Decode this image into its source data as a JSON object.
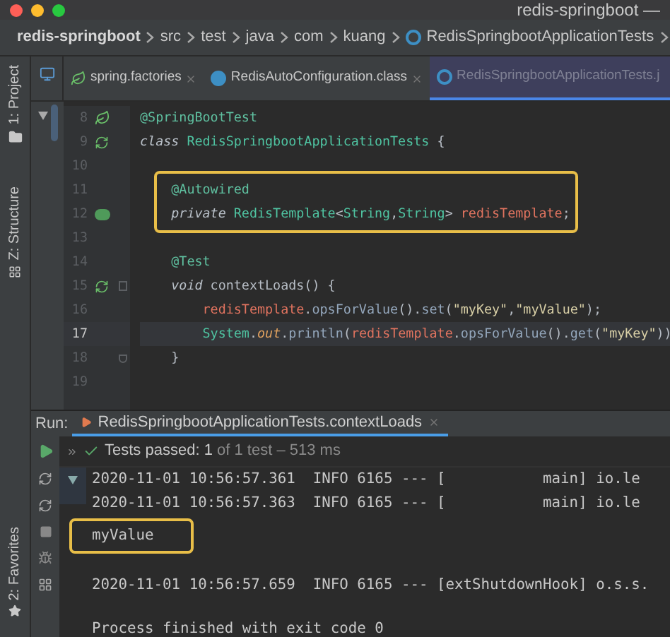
{
  "window": {
    "title": "redis-springboot —"
  },
  "breadcrumbs": [
    {
      "label": "redis-springboot",
      "kind": "project"
    },
    {
      "label": "src",
      "kind": "folder"
    },
    {
      "label": "test",
      "kind": "folder"
    },
    {
      "label": "java",
      "kind": "folder"
    },
    {
      "label": "com",
      "kind": "folder"
    },
    {
      "label": "kuang",
      "kind": "folder"
    },
    {
      "label": "RedisSpringbootApplicationTests",
      "kind": "class"
    }
  ],
  "tool_strip": {
    "top": "1: Project",
    "middle": "Z: Structure",
    "bottom": "2: Favorites"
  },
  "editor_tabs": [
    {
      "label": "spring.factories",
      "kind": "spring",
      "selected": false
    },
    {
      "label": "RedisAutoConfiguration.class",
      "kind": "class",
      "selected": false
    },
    {
      "label": "RedisSpringbootApplicationTests.j",
      "kind": "test",
      "selected": true
    }
  ],
  "code_lines": [
    {
      "number": "8",
      "gutter": {
        "kind": "spring"
      },
      "current": false,
      "boxed": false,
      "tokens": [
        {
          "text": "@SpringBootTest",
          "kind": "annotation"
        }
      ]
    },
    {
      "number": "9",
      "gutter": {
        "kind": "run"
      },
      "current": false,
      "boxed": false,
      "tokens": [
        {
          "text": "class",
          "kind": "keyword"
        },
        {
          "text": " RedisSpringbootApplicationTests",
          "kind": "type"
        },
        {
          "text": " {",
          "kind": "plain"
        }
      ]
    },
    {
      "number": "10",
      "current": false,
      "boxed": false
    },
    {
      "number": "11",
      "current": false,
      "boxed": true,
      "tokens": [
        {
          "text": "    @Autowired",
          "kind": "annotation"
        }
      ]
    },
    {
      "number": "12",
      "gutter": {
        "kind": "bean"
      },
      "current": false,
      "boxed": true,
      "tokens": [
        {
          "text": "    private",
          "kind": "keyword"
        },
        {
          "text": " RedisTemplate",
          "kind": "type"
        },
        {
          "text": "<",
          "kind": "plain"
        },
        {
          "text": "String",
          "kind": "type"
        },
        {
          "text": ",",
          "kind": "plain"
        },
        {
          "text": "String",
          "kind": "type"
        },
        {
          "text": ">",
          "kind": "plain"
        },
        {
          "text": " redisTemplate",
          "kind": "field"
        },
        {
          "text": ";",
          "kind": "plain"
        }
      ]
    },
    {
      "number": "13",
      "current": false,
      "boxed": false
    },
    {
      "number": "14",
      "current": false,
      "boxed": false,
      "tokens": [
        {
          "text": "    @Test",
          "kind": "annotation"
        }
      ]
    },
    {
      "number": "15",
      "gutter": {
        "kind": "run"
      },
      "fold": {
        "kind": "start"
      },
      "current": false,
      "boxed": false,
      "tokens": [
        {
          "text": "    void",
          "kind": "keyword"
        },
        {
          "text": " contextLoads() {",
          "kind": "plain"
        }
      ]
    },
    {
      "number": "16",
      "current": false,
      "boxed": false,
      "tokens": [
        {
          "text": "        redisTemplate",
          "kind": "field"
        },
        {
          "text": ".",
          "kind": "plain"
        },
        {
          "text": "opsForValue",
          "kind": "method"
        },
        {
          "text": "().",
          "kind": "plain"
        },
        {
          "text": "set",
          "kind": "method"
        },
        {
          "text": "(",
          "kind": "plain"
        },
        {
          "text": "\"myKey\"",
          "kind": "string"
        },
        {
          "text": ",",
          "kind": "plain"
        },
        {
          "text": "\"myValue\"",
          "kind": "string"
        },
        {
          "text": ");",
          "kind": "plain"
        }
      ]
    },
    {
      "number": "17",
      "current": true,
      "boxed": false,
      "tokens": [
        {
          "text": "        System",
          "kind": "type"
        },
        {
          "text": ".",
          "kind": "plain"
        },
        {
          "text": "out",
          "kind": "static"
        },
        {
          "text": ".",
          "kind": "plain"
        },
        {
          "text": "println",
          "kind": "method"
        },
        {
          "text": "(",
          "kind": "plain"
        },
        {
          "text": "redisTemplate",
          "kind": "field"
        },
        {
          "text": ".",
          "kind": "plain"
        },
        {
          "text": "opsForValue",
          "kind": "method"
        },
        {
          "text": "().",
          "kind": "plain"
        },
        {
          "text": "get",
          "kind": "method"
        },
        {
          "text": "(",
          "kind": "plain"
        },
        {
          "text": "\"myKey\"",
          "kind": "string"
        },
        {
          "text": "))",
          "kind": "plain"
        }
      ]
    },
    {
      "number": "18",
      "fold": {
        "kind": "end"
      },
      "current": false,
      "boxed": false,
      "tokens": [
        {
          "text": "    }",
          "kind": "plain"
        }
      ]
    },
    {
      "number": "19",
      "current": false,
      "boxed": false
    }
  ],
  "run_panel": {
    "label": "Run:",
    "tab": {
      "label": "RedisSpringbootApplicationTests.contextLoads",
      "selected": true
    },
    "status": {
      "prefix": "Tests passed:",
      "count": "1",
      "rest": "of 1 test – 513 ms"
    },
    "console": [
      {
        "text": "2020-11-01 10:56:57.361  INFO 6165 --- [           main] io.le",
        "boxed": false
      },
      {
        "text": "2020-11-01 10:56:57.363  INFO 6165 --- [           main] io.le",
        "boxed": false
      },
      {
        "text": "myValue",
        "boxed": true
      },
      {
        "text": "2020-11-01 10:56:57.659  INFO 6165 --- [extShutdownHook] o.s.s.",
        "boxed": false
      },
      {
        "text": "Process finished with exit code 0",
        "boxed": false
      }
    ]
  }
}
